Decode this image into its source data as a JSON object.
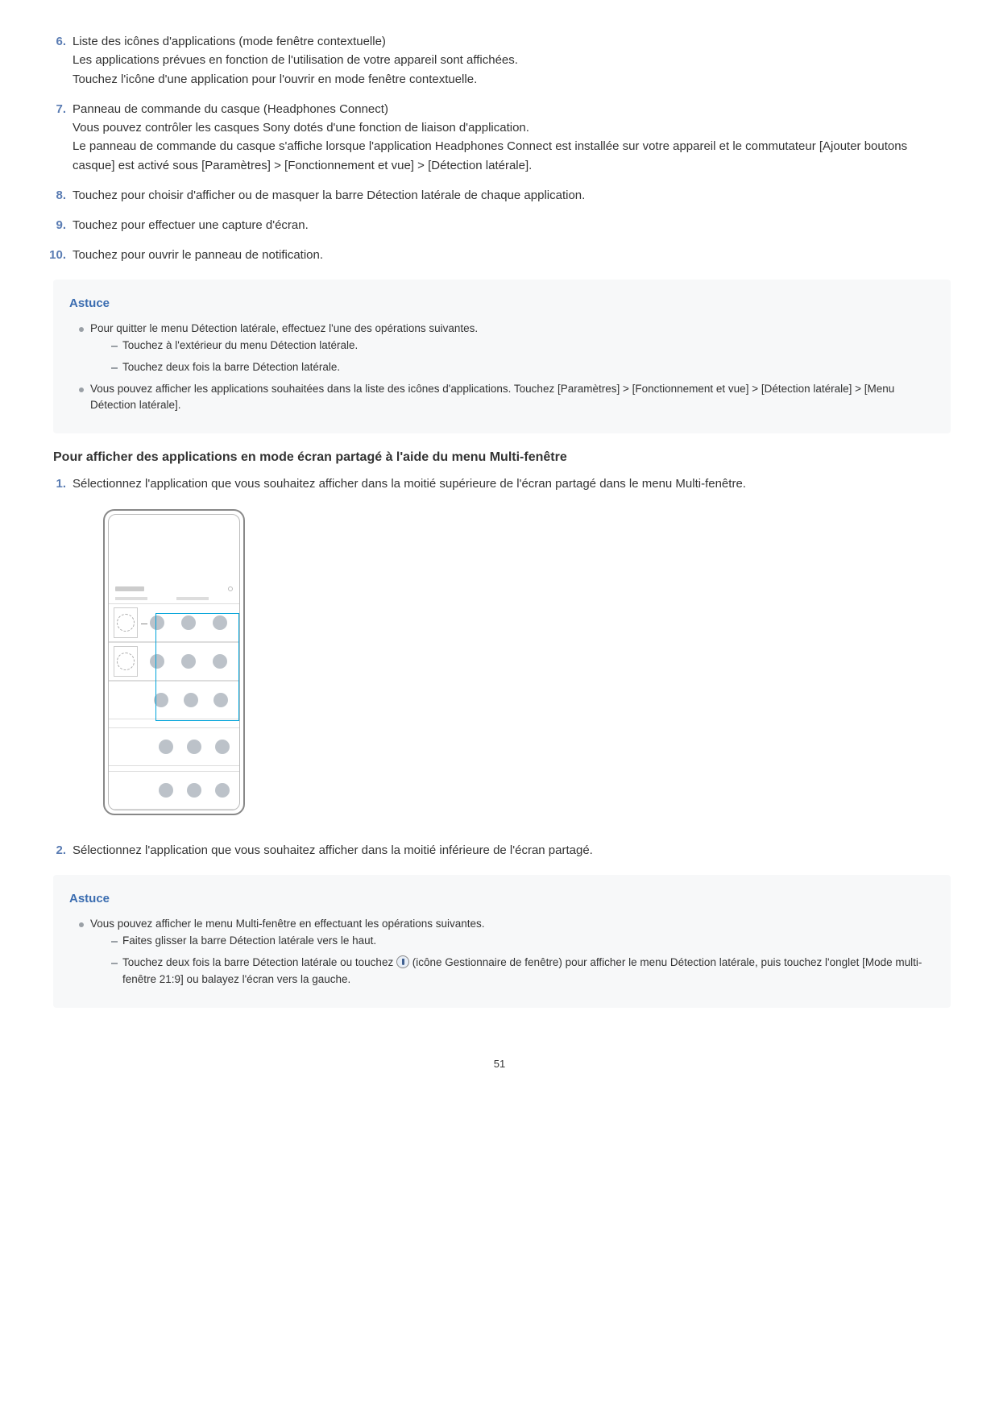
{
  "listItems": [
    {
      "num": "6.",
      "lines": [
        "Liste des icônes d'applications (mode fenêtre contextuelle)",
        "Les applications prévues en fonction de l'utilisation de votre appareil sont affichées.",
        "Touchez l'icône d'une application pour l'ouvrir en mode fenêtre contextuelle."
      ]
    },
    {
      "num": "7.",
      "lines": [
        "Panneau de commande du casque (Headphones Connect)",
        "Vous pouvez contrôler les casques Sony dotés d'une fonction de liaison d'application.",
        "Le panneau de commande du casque s'affiche lorsque l'application Headphones Connect est installée sur votre appareil et le commutateur [Ajouter boutons casque] est activé sous [Paramètres] > [Fonctionnement et vue] > [Détection latérale]."
      ]
    },
    {
      "num": "8.",
      "lines": [
        "Touchez pour choisir d'afficher ou de masquer la barre Détection latérale de chaque application."
      ]
    },
    {
      "num": "9.",
      "lines": [
        "Touchez pour effectuer une capture d'écran."
      ]
    },
    {
      "num": "10.",
      "lines": [
        "Touchez pour ouvrir le panneau de notification."
      ]
    }
  ],
  "tip1": {
    "title": "Astuce",
    "bullets": [
      {
        "text": "Pour quitter le menu Détection latérale, effectuez l'une des opérations suivantes.",
        "sub": [
          "Touchez à l'extérieur du menu Détection latérale.",
          "Touchez deux fois la barre Détection latérale."
        ]
      },
      {
        "text": "Vous pouvez afficher les applications souhaitées dans la liste des icônes d'applications. Touchez [Paramètres] > [Fonctionnement et vue] > [Détection latérale] > [Menu Détection latérale]."
      }
    ]
  },
  "sectionHeading": "Pour afficher des applications en mode écran partagé à l'aide du menu Multi-fenêtre",
  "steps": [
    {
      "num": "1.",
      "text": "Sélectionnez l'application que vous souhaitez afficher dans la moitié supérieure de l'écran partagé dans le menu Multi-fenêtre."
    },
    {
      "num": "2.",
      "text": "Sélectionnez l'application que vous souhaitez afficher dans la moitié inférieure de l'écran partagé."
    }
  ],
  "tip2": {
    "title": "Astuce",
    "bullets": [
      {
        "text": "Vous pouvez afficher le menu Multi-fenêtre en effectuant les opérations suivantes.",
        "sub": [
          "Faites glisser la barre Détection latérale vers le haut.",
          {
            "pre": "Touchez deux fois la barre Détection latérale ou touchez ",
            "iconLabel": "(icône Gestionnaire de fenêtre)",
            "post": " pour afficher le menu Détection latérale, puis touchez l'onglet [Mode multi-fenêtre 21:9] ou balayez l'écran vers la gauche."
          }
        ]
      }
    ]
  },
  "pageNumber": "51"
}
